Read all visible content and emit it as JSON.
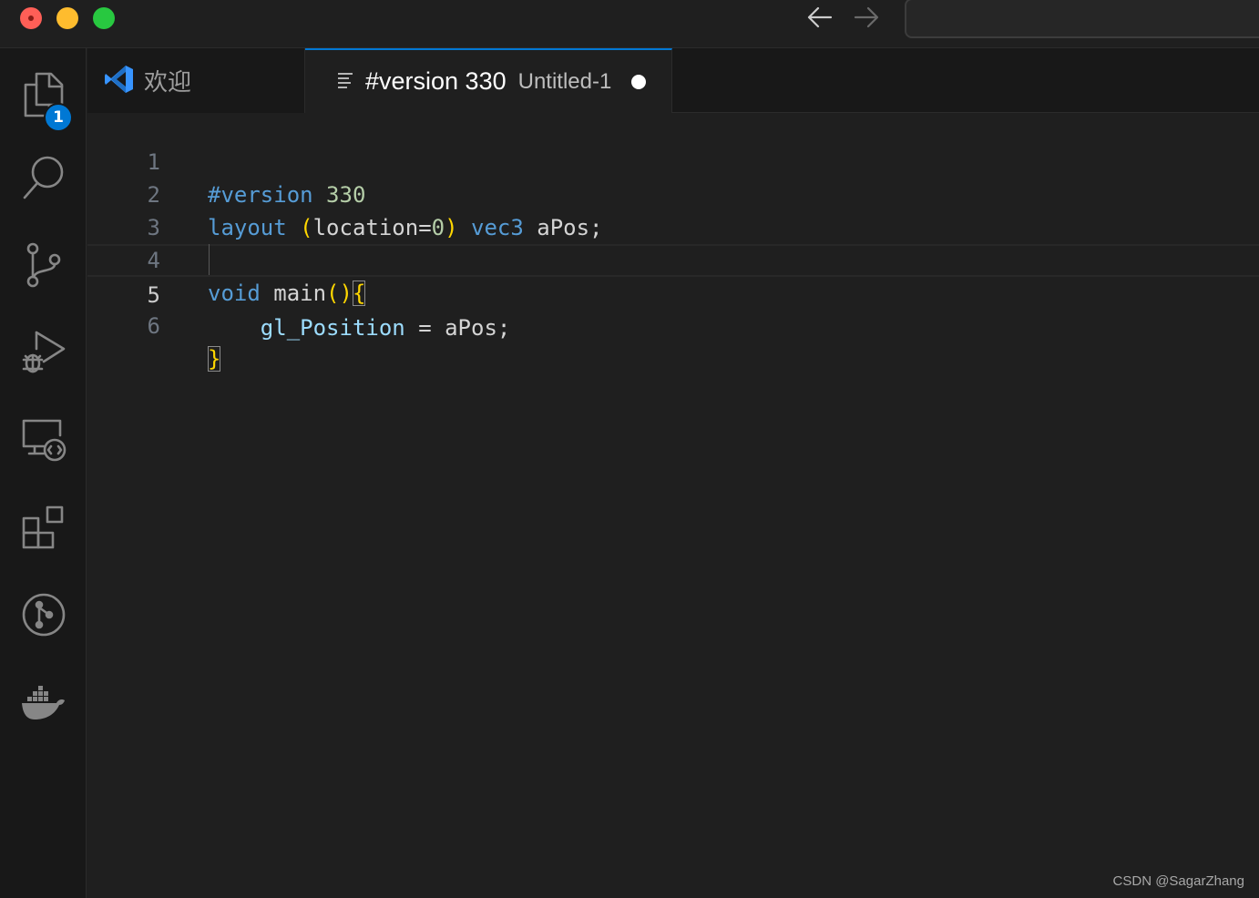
{
  "titlebar": {
    "back_icon": "arrow-left-icon",
    "forward_icon": "arrow-right-icon",
    "command_center_text": ""
  },
  "activitybar": {
    "items": [
      {
        "name": "explorer",
        "icon": "files-icon",
        "badge": "1"
      },
      {
        "name": "search",
        "icon": "search-icon"
      },
      {
        "name": "source-control",
        "icon": "source-control-icon"
      },
      {
        "name": "run-debug",
        "icon": "run-debug-icon"
      },
      {
        "name": "remote-explorer",
        "icon": "remote-explorer-icon"
      },
      {
        "name": "extensions",
        "icon": "extensions-icon"
      },
      {
        "name": "gitlens",
        "icon": "git-graph-icon"
      },
      {
        "name": "docker",
        "icon": "docker-icon"
      }
    ]
  },
  "tabs": [
    {
      "label": "欢迎",
      "icon": "vscode-logo-icon",
      "active": false
    },
    {
      "label": "#version 330",
      "description": "Untitled-1",
      "icon": "text-lines-icon",
      "active": true,
      "dirty": true
    }
  ],
  "editor": {
    "current_line": 5,
    "lines": [
      {
        "number": "1",
        "tokens": [
          "#version",
          " ",
          "330"
        ]
      },
      {
        "number": "2",
        "tokens": [
          "layout",
          " ",
          "(",
          "location=",
          "0",
          ")",
          " ",
          "vec3",
          " aPos;"
        ]
      },
      {
        "number": "3",
        "tokens": []
      },
      {
        "number": "4",
        "tokens": [
          "void",
          " main",
          "()",
          "{"
        ]
      },
      {
        "number": "5",
        "tokens": [
          "    ",
          "gl_Position",
          " = aPos;"
        ]
      },
      {
        "number": "6",
        "tokens": [
          "}"
        ]
      }
    ]
  },
  "colors": {
    "keyword": "#569cd6",
    "number": "#b5cea8",
    "variable": "#9cdcfe",
    "bracket": "#ffd700",
    "accent": "#0078d4"
  },
  "watermark": "CSDN @SagarZhang"
}
